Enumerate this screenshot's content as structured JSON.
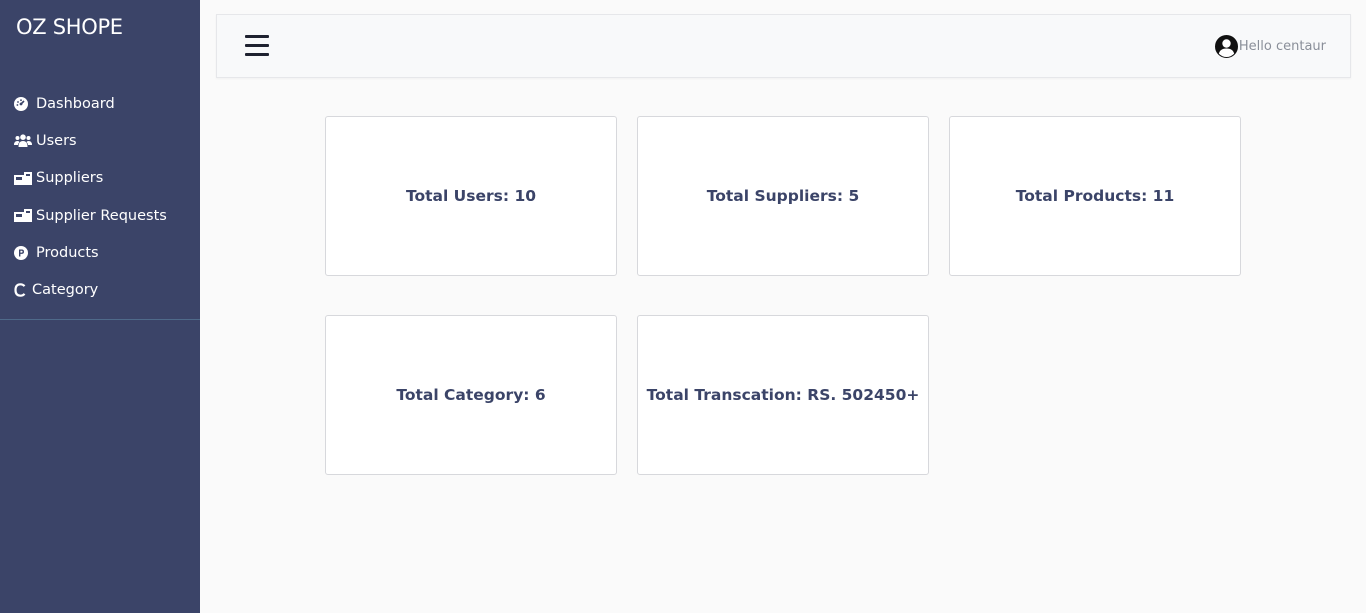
{
  "brand": "OZ SHOPE",
  "sidebar": {
    "items": [
      {
        "label": "Dashboard",
        "icon": "dashboard-icon"
      },
      {
        "label": "Users",
        "icon": "users-icon"
      },
      {
        "label": "Suppliers",
        "icon": "suppliers-icon"
      },
      {
        "label": "Supplier Requests",
        "icon": "supplier-requests-icon"
      },
      {
        "label": "Products",
        "icon": "products-icon"
      },
      {
        "label": "Category",
        "icon": "category-icon"
      }
    ]
  },
  "header": {
    "greeting": "Hello centaur"
  },
  "cards": [
    {
      "label": "Total Users: 10"
    },
    {
      "label": "Total Suppliers: 5"
    },
    {
      "label": "Total Products: 11"
    },
    {
      "label": "Total Category: 6"
    },
    {
      "label": "Total Transcation: RS. 502450+"
    }
  ],
  "colors": {
    "sidebar_bg": "#3b4468",
    "page_bg": "#fafafa",
    "card_text": "#3b4468"
  }
}
